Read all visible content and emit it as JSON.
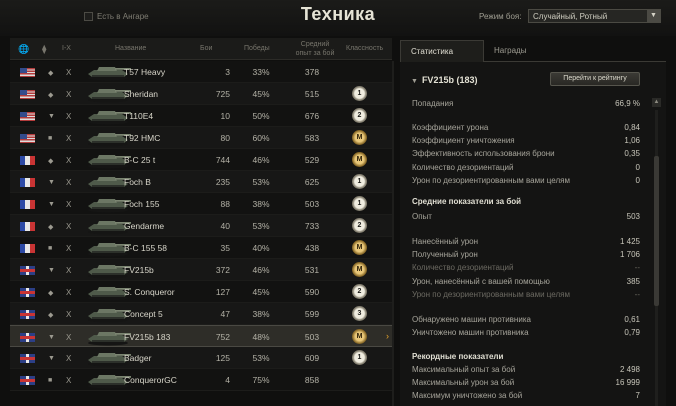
{
  "header": {
    "title": "Техника",
    "in_hangar_label": "Есть в Ангаре",
    "mode_label": "Режим боя:",
    "mode_value": "Случайный, Ротный"
  },
  "table": {
    "headers": {
      "class": "",
      "tier": "I-X",
      "name": "Название",
      "battles": "Бои",
      "wins": "Победы",
      "xp": "Средний опыт за бой",
      "mastery": "Классность"
    },
    "rows": [
      {
        "nation": "us",
        "cls": "◆",
        "tier": "X",
        "name": "T57 Heavy",
        "battles": "3",
        "wins": "33%",
        "xp": "378",
        "badge": ""
      },
      {
        "nation": "us",
        "cls": "◆",
        "tier": "X",
        "name": "Sheridan",
        "battles": "725",
        "wins": "45%",
        "xp": "515",
        "badge": "1"
      },
      {
        "nation": "us",
        "cls": "▼",
        "tier": "X",
        "name": "T110E4",
        "battles": "10",
        "wins": "50%",
        "xp": "676",
        "badge": "2"
      },
      {
        "nation": "us",
        "cls": "■",
        "tier": "X",
        "name": "T92 HMC",
        "battles": "80",
        "wins": "60%",
        "xp": "583",
        "badge": "M"
      },
      {
        "nation": "fr",
        "cls": "◆",
        "tier": "X",
        "name": "B-C 25 t",
        "battles": "744",
        "wins": "46%",
        "xp": "529",
        "badge": "M"
      },
      {
        "nation": "fr",
        "cls": "▼",
        "tier": "X",
        "name": "Foch B",
        "battles": "235",
        "wins": "53%",
        "xp": "625",
        "badge": "1"
      },
      {
        "nation": "fr",
        "cls": "▼",
        "tier": "X",
        "name": "Foch 155",
        "battles": "88",
        "wins": "38%",
        "xp": "503",
        "badge": "1"
      },
      {
        "nation": "fr",
        "cls": "◆",
        "tier": "X",
        "name": "Gendarme",
        "battles": "40",
        "wins": "53%",
        "xp": "733",
        "badge": "2"
      },
      {
        "nation": "fr",
        "cls": "■",
        "tier": "X",
        "name": "B-C 155 58",
        "battles": "35",
        "wins": "40%",
        "xp": "438",
        "badge": "M"
      },
      {
        "nation": "gb",
        "cls": "▼",
        "tier": "X",
        "name": "FV215b",
        "battles": "372",
        "wins": "46%",
        "xp": "531",
        "badge": "M"
      },
      {
        "nation": "gb",
        "cls": "◆",
        "tier": "X",
        "name": "S. Conqueror",
        "battles": "127",
        "wins": "45%",
        "xp": "590",
        "badge": "2"
      },
      {
        "nation": "gb",
        "cls": "◆",
        "tier": "X",
        "name": "Concept 5",
        "battles": "47",
        "wins": "38%",
        "xp": "599",
        "badge": "3"
      },
      {
        "nation": "gb",
        "cls": "▼",
        "tier": "X",
        "name": "FV215b 183",
        "battles": "752",
        "wins": "48%",
        "xp": "503",
        "badge": "M",
        "selected": true
      },
      {
        "nation": "gb",
        "cls": "▼",
        "tier": "X",
        "name": "Badger",
        "battles": "125",
        "wins": "53%",
        "xp": "609",
        "badge": "1"
      },
      {
        "nation": "gb",
        "cls": "■",
        "tier": "X",
        "name": "ConquerorGC",
        "battles": "4",
        "wins": "75%",
        "xp": "858",
        "badge": ""
      }
    ]
  },
  "panel": {
    "tab_stats": "Статистика",
    "tab_awards": "Награды",
    "vehicle": "FV215b (183)",
    "rating_button": "Перейти к рейтингу",
    "hits_label": "Попадания",
    "hits_value": "66,9 %",
    "rows1": [
      {
        "label": "Коэффициент урона",
        "value": "0,84"
      },
      {
        "label": "Коэффициент уничтожения",
        "value": "1,06"
      },
      {
        "label": "Эффективность использования брони",
        "value": "0,35"
      },
      {
        "label": "Количество дезориентаций",
        "value": "0"
      },
      {
        "label": "Урон по дезориентированным вами целям",
        "value": "0"
      }
    ],
    "avg_title": "Средние показатели за бой",
    "xp_label": "Опыт",
    "xp_value": "503",
    "rows2": [
      {
        "label": "Нанесённый урон",
        "value": "1 425"
      },
      {
        "label": "Полученный урон",
        "value": "1 706"
      },
      {
        "label": "Количество дезориентаций",
        "value": "--"
      },
      {
        "label": "Урон, нанесённый с вашей помощью",
        "value": "385"
      },
      {
        "label": "Урон по дезориентированным вами целям",
        "value": "--"
      }
    ],
    "rows3": [
      {
        "label": "Обнаружено машин противника",
        "value": "0,61"
      },
      {
        "label": "Уничтожено машин противника",
        "value": "0,79"
      }
    ],
    "rec_title": "Рекордные показатели",
    "rows4": [
      {
        "label": "Максимальный опыт за бой",
        "value": "2 498"
      },
      {
        "label": "Максимальный урон за бой",
        "value": "16 999"
      },
      {
        "label": "Максимум уничтожено за бой",
        "value": "7"
      }
    ]
  }
}
